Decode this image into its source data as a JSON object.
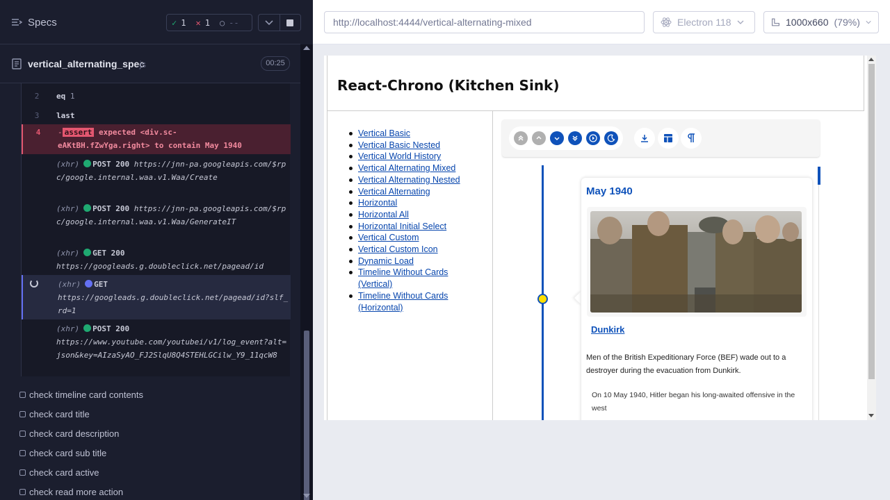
{
  "reporter": {
    "title": "Specs",
    "stats": {
      "passed_mark": "✓",
      "passed": "1",
      "failed_mark": "✕",
      "failed": "1",
      "pending_mark": "○",
      "pending": "--"
    },
    "spec": {
      "name": "vertical_alternating_spec",
      "ext": ".js",
      "duration": "00:25"
    },
    "commands": {
      "c2": {
        "num": "2",
        "name": "eq",
        "arg": "1"
      },
      "c3": {
        "num": "3",
        "name": "last"
      },
      "c4": {
        "num": "4",
        "dash": "-",
        "badge": "assert",
        "line1": "expected <div.sc-",
        "line2": "eAKtBH.fZwYga.right> to contain May 1940"
      },
      "x1": {
        "tag": "(xhr)",
        "method": "POST 200",
        "url": "https://jnn-pa.googleapis.com/$rpc/google.internal.waa.v1.Waa/Create"
      },
      "x2": {
        "tag": "(xhr)",
        "method": "POST 200",
        "url": "https://jnn-pa.googleapis.com/$rpc/google.internal.waa.v1.Waa/GenerateIT"
      },
      "x3": {
        "tag": "(xhr)",
        "method": "GET 200",
        "url": "https://googleads.g.doubleclick.net/pagead/id"
      },
      "x4": {
        "tag": "(xhr)",
        "method": "GET",
        "url": "https://googleads.g.doubleclick.net/pagead/id?slf_rd=1"
      },
      "x5": {
        "tag": "(xhr)",
        "method": "POST 200",
        "url": "https://www.youtube.com/youtubei/v1/log_event?alt=json&key=AIzaSyAO_FJ2SlqU8Q4STEHLGCilw_Y9_11qcW8"
      }
    },
    "tests": [
      "check timeline card contents",
      "check card title",
      "check card description",
      "check card sub title",
      "check card active",
      "check read more action"
    ]
  },
  "runner": {
    "url": "http://localhost:4444/vertical-alternating-mixed",
    "browser": "Electron 118",
    "viewport": "1000x660",
    "scale": "(79%)"
  },
  "app": {
    "title": "React-Chrono (Kitchen Sink)",
    "nav": [
      "Vertical Basic",
      "Vertical Basic Nested",
      "Vertical World History",
      "Vertical Alternating Mixed",
      "Vertical Alternating Nested",
      "Vertical Alternating",
      "Horizontal",
      "Horizontal All",
      "Horizontal Initial Select",
      "Vertical Custom",
      "Vertical Custom Icon",
      "Dynamic Load",
      "Timeline Without Cards (Vertical)",
      "Timeline Without Cards (Horizontal)"
    ],
    "card": {
      "date": "May 1940",
      "title": "Dunkirk",
      "subtitle": "Men of the British Expeditionary Force (BEF) wade out to a destroyer during the evacuation from Dunkirk.",
      "body": "On 10 May 1940, Hitler began his long-awaited offensive in the west"
    },
    "colors": {
      "primary": "#0f52ba",
      "point": "#ffdf00"
    }
  }
}
